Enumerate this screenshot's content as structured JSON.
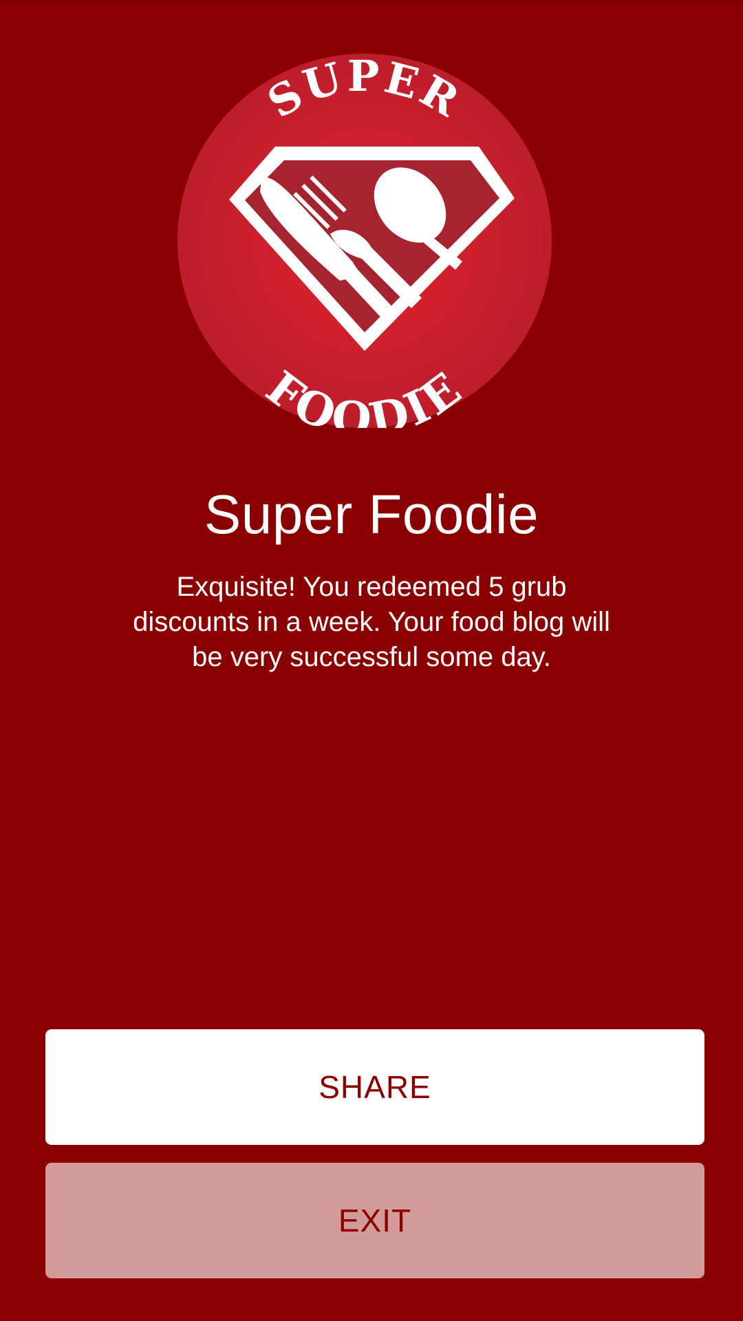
{
  "badge": {
    "top_text": "SUPER",
    "bottom_text": "FOODIE",
    "icon": "utensils-diamond-icon"
  },
  "achievement": {
    "title": "Super Foodie",
    "message": "Exquisite! You redeemed 5 grub discounts in a week. Your food blog will be very successful some day."
  },
  "actions": {
    "share_label": "SHARE",
    "exit_label": "EXIT"
  },
  "colors": {
    "background": "#8a0000",
    "badge_red": "#d41f2e",
    "exit_button": "#d29a98"
  }
}
